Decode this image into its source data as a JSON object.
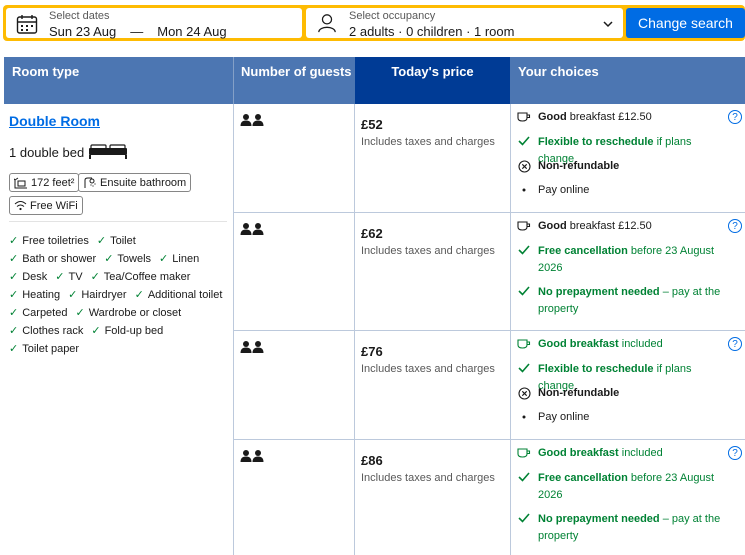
{
  "search": {
    "dates_label": "Select dates",
    "check_in": "Sun 23 Aug",
    "check_out": "Mon 24 Aug",
    "occupancy_label": "Select occupancy",
    "occupancy_value": "2 adults · 0 children · 1 room",
    "change_button": "Change search"
  },
  "headers": {
    "room_type": "Room type",
    "guests": "Number of guests",
    "price": "Today's price",
    "choices": "Your choices"
  },
  "room": {
    "name": "Double Room",
    "bed": "1 double bed",
    "size": "172 feet²",
    "bathroom": "Ensuite bathroom",
    "wifi": "Free WiFi",
    "amenities": [
      [
        "Free toiletries",
        "Toilet"
      ],
      [
        "Bath or shower",
        "Towels",
        "Linen"
      ],
      [
        "Desk",
        "TV",
        "Tea/Coffee maker"
      ],
      [
        "Heating",
        "Hairdryer",
        "Additional toilet"
      ],
      [
        "Carpeted",
        "Wardrobe or closet"
      ],
      [
        "Clothes rack",
        "Fold-up bed"
      ],
      [
        "Toilet paper"
      ]
    ]
  },
  "options": [
    {
      "price": "£52",
      "tax": "Includes taxes and charges",
      "breakfast_b": "Good",
      "breakfast_rest": " breakfast £12.50",
      "c2_b": "Flexible to reschedule",
      "c2_rest": " if plans change",
      "c3_b": "Non-refundable",
      "c4": "Pay online"
    },
    {
      "price": "£62",
      "tax": "Includes taxes and charges",
      "breakfast_b": "Good",
      "breakfast_rest": " breakfast £12.50",
      "c2_b": "Free cancellation",
      "c2_rest": " before 23 August 2026",
      "c3_b": "No prepayment needed",
      "c3_rest": " – pay at the property"
    },
    {
      "price": "£76",
      "tax": "Includes taxes and charges",
      "breakfast_b": "Good breakfast",
      "breakfast_rest": " included",
      "c2_b": "Flexible to reschedule",
      "c2_rest": " if plans change",
      "c3_b": "Non-refundable",
      "c4": "Pay online"
    },
    {
      "price": "£86",
      "tax": "Includes taxes and charges",
      "breakfast_b": "Good breakfast",
      "breakfast_rest": " included",
      "c2_b": "Free cancellation",
      "c2_rest": " before 23 August 2026",
      "c3_b": "No prepayment needed",
      "c3_rest": " – pay at the property"
    }
  ],
  "info_glyph": "?",
  "colors": {
    "accent": "#006ce4",
    "header": "#4c76b2",
    "price_header": "#003b95",
    "green": "#008234",
    "search_border": "#febb02"
  }
}
